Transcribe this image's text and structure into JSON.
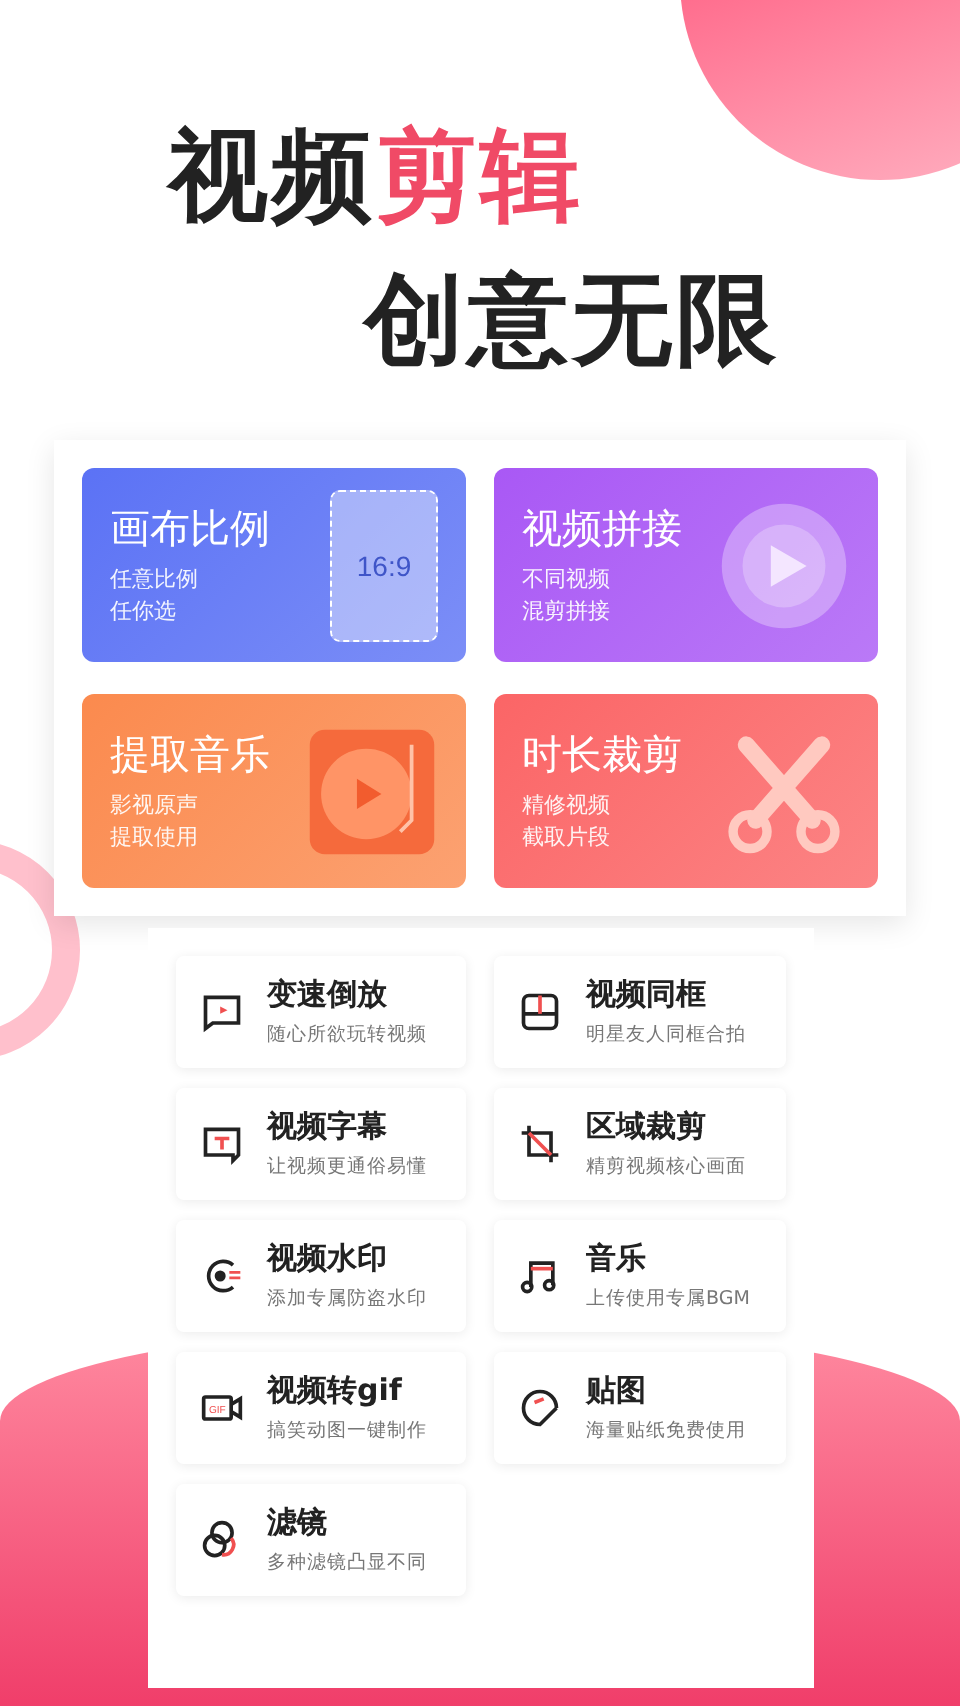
{
  "headline": {
    "plain": "视频",
    "accent": "剪辑"
  },
  "subheadline": "创意无限",
  "features": [
    {
      "kind": "ratio",
      "title": "画布比例",
      "lines": [
        "任意比例",
        "任你选"
      ],
      "icon_text": "16:9",
      "color": "#5b72f5"
    },
    {
      "kind": "splice",
      "title": "视频拼接",
      "lines": [
        "不同视频",
        "混剪拼接"
      ],
      "color": "#a958f5"
    },
    {
      "kind": "music",
      "title": "提取音乐",
      "lines": [
        "影视原声",
        "提取使用"
      ],
      "color": "#fb8a4e"
    },
    {
      "kind": "cut",
      "title": "时长裁剪",
      "lines": [
        "精修视频",
        "截取片段"
      ],
      "color": "#fb6566"
    }
  ],
  "tools": [
    {
      "kind": "speed",
      "title": "变速倒放",
      "desc": "随心所欲玩转视频"
    },
    {
      "kind": "split",
      "title": "视频同框",
      "desc": "明星友人同框合拍"
    },
    {
      "kind": "subtitle",
      "title": "视频字幕",
      "desc": "让视频更通俗易懂"
    },
    {
      "kind": "crop",
      "title": "区域裁剪",
      "desc": "精剪视频核心画面"
    },
    {
      "kind": "watermark",
      "title": "视频水印",
      "desc": "添加专属防盗水印"
    },
    {
      "kind": "note",
      "title": "音乐",
      "desc": "上传使用专属BGM"
    },
    {
      "kind": "gif",
      "title": "视频转gif",
      "desc": "搞笑动图一键制作",
      "icon_text": "GIF"
    },
    {
      "kind": "sticker",
      "title": "贴图",
      "desc": "海量贴纸免费使用"
    },
    {
      "kind": "filter",
      "title": "滤镜",
      "desc": "多种滤镜凸显不同"
    }
  ]
}
